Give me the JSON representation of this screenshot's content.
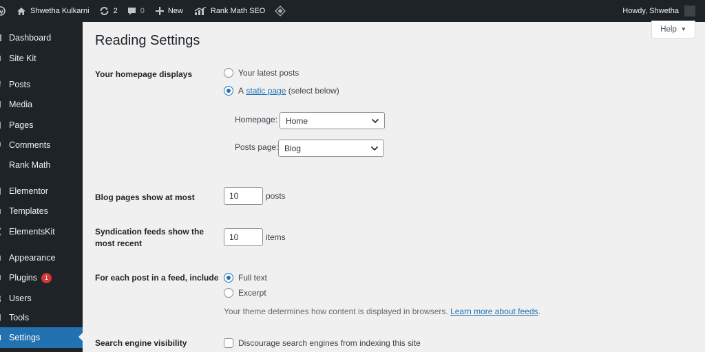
{
  "admin_bar": {
    "site_name": "Shwetha Kulkarni",
    "updates_count": "2",
    "comments_count": "0",
    "new_label": "New",
    "seo_label": "Rank Math SEO",
    "greeting": "Howdy, Shwetha"
  },
  "sidebar": {
    "items": [
      {
        "label": "Dashboard",
        "icon": "dashboard-icon"
      },
      {
        "label": "Site Kit",
        "icon": "site-kit-icon"
      },
      {
        "label": "Posts",
        "icon": "pin-icon"
      },
      {
        "label": "Media",
        "icon": "media-icon"
      },
      {
        "label": "Pages",
        "icon": "page-icon"
      },
      {
        "label": "Comments",
        "icon": "comment-icon"
      },
      {
        "label": "Rank Math",
        "icon": "rank-math-icon"
      },
      {
        "label": "Elementor",
        "icon": "elementor-icon"
      },
      {
        "label": "Templates",
        "icon": "folder-icon"
      },
      {
        "label": "ElementsKit",
        "icon": "elementskit-icon"
      },
      {
        "label": "Appearance",
        "icon": "brush-icon"
      },
      {
        "label": "Plugins",
        "icon": "plug-icon",
        "badge": "1"
      },
      {
        "label": "Users",
        "icon": "user-icon"
      },
      {
        "label": "Tools",
        "icon": "wrench-icon"
      },
      {
        "label": "Settings",
        "icon": "settings-icon"
      }
    ],
    "current": "Settings"
  },
  "page": {
    "help_label": "Help",
    "title": "Reading Settings"
  },
  "homepage_displays": {
    "label": "Your homepage displays",
    "option_latest": "Your latest posts",
    "option_static_prefix": "A",
    "option_static_link": "static page",
    "option_static_suffix": "(select below)",
    "selected": "static page",
    "homepage_label": "Homepage:",
    "homepage_value": "Home",
    "posts_page_label": "Posts page:",
    "posts_page_value": "Blog"
  },
  "blog_pages": {
    "label": "Blog pages show at most",
    "value": "10",
    "suffix": "posts"
  },
  "syndication": {
    "label_line1": "Syndication feeds show the",
    "label_line2": "most recent",
    "value": "10",
    "suffix": "items"
  },
  "feed_include": {
    "label": "For each post in a feed, include",
    "option_full": "Full text",
    "option_excerpt": "Excerpt",
    "selected": "Full text",
    "description": "Your theme determines how content is displayed in browsers.",
    "learn_more_link": "Learn more about feeds",
    "description_end": "."
  },
  "search_visibility": {
    "label": "Search engine visibility",
    "checkbox_label": "Discourage search engines from indexing this site",
    "checked": false
  },
  "colors": {
    "admin_dark": "#1d2327",
    "accent_blue": "#2271b1",
    "badge_red": "#d63638"
  }
}
